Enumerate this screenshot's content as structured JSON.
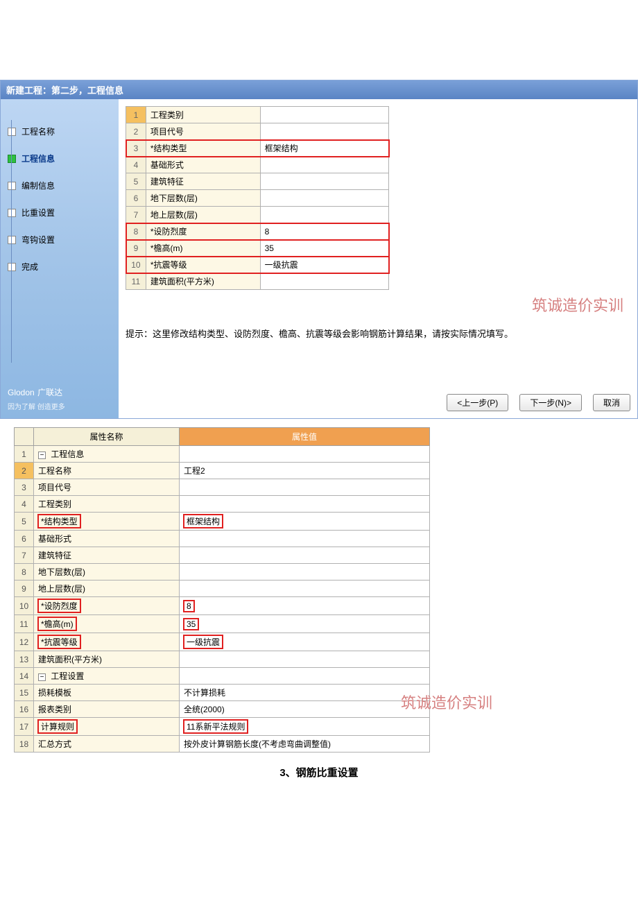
{
  "dialog": {
    "title": "新建工程：第二步，工程信息",
    "nav": [
      "工程名称",
      "工程信息",
      "编制信息",
      "比重设置",
      "弯钩设置",
      "完成"
    ],
    "brand": "Glodon",
    "brand_cn": "广联达",
    "slogan": "因为了解 创造更多",
    "tip": "提示：这里修改结构类型、设防烈度、檐高、抗震等级会影响钢筋计算结果，请按实际情况填写。",
    "buttons": {
      "prev": "<上一步(P)",
      "next": "下一步(N)>",
      "cancel": "取消"
    },
    "rows": [
      {
        "n": "1",
        "label": "工程类别",
        "val": ""
      },
      {
        "n": "2",
        "label": "项目代号",
        "val": ""
      },
      {
        "n": "3",
        "label": "*结构类型",
        "val": "框架结构",
        "red": true
      },
      {
        "n": "4",
        "label": "基础形式",
        "val": ""
      },
      {
        "n": "5",
        "label": "建筑特征",
        "val": ""
      },
      {
        "n": "6",
        "label": "地下层数(层)",
        "val": ""
      },
      {
        "n": "7",
        "label": "地上层数(层)",
        "val": ""
      },
      {
        "n": "8",
        "label": "*设防烈度",
        "val": "8",
        "red": true
      },
      {
        "n": "9",
        "label": "*檐高(m)",
        "val": "35",
        "red": true
      },
      {
        "n": "10",
        "label": "*抗震等级",
        "val": "一级抗震",
        "red": true
      },
      {
        "n": "11",
        "label": "建筑面积(平方米)",
        "val": ""
      }
    ]
  },
  "table2": {
    "header_name": "属性名称",
    "header_val": "属性值",
    "rows": [
      {
        "n": "1",
        "label": "工程信息",
        "val": "",
        "group": true
      },
      {
        "n": "2",
        "label": "工程名称",
        "val": "工程2",
        "sel": true
      },
      {
        "n": "3",
        "label": "项目代号",
        "val": ""
      },
      {
        "n": "4",
        "label": "工程类别",
        "val": ""
      },
      {
        "n": "5",
        "label": "*结构类型",
        "val": "框架结构",
        "redlabel": true,
        "redval": true
      },
      {
        "n": "6",
        "label": "基础形式",
        "val": ""
      },
      {
        "n": "7",
        "label": "建筑特征",
        "val": ""
      },
      {
        "n": "8",
        "label": "地下层数(层)",
        "val": ""
      },
      {
        "n": "9",
        "label": "地上层数(层)",
        "val": ""
      },
      {
        "n": "10",
        "label": "*设防烈度",
        "val": "8",
        "redlabel": true,
        "redval": true
      },
      {
        "n": "11",
        "label": "*檐高(m)",
        "val": "35",
        "redlabel": true,
        "redval": true
      },
      {
        "n": "12",
        "label": "*抗震等级",
        "val": "一级抗震",
        "redlabel": true,
        "redval": true
      },
      {
        "n": "13",
        "label": "建筑面积(平方米)",
        "val": ""
      },
      {
        "n": "14",
        "label": "工程设置",
        "val": "",
        "group": true
      },
      {
        "n": "15",
        "label": "损耗模板",
        "val": "不计算损耗"
      },
      {
        "n": "16",
        "label": "报表类别",
        "val": "全统(2000)"
      },
      {
        "n": "17",
        "label": "计算规则",
        "val": "11系新平法规则",
        "redlabel": true,
        "redval": true
      },
      {
        "n": "18",
        "label": "汇总方式",
        "val": "按外皮计算钢筋长度(不考虑弯曲调整值)"
      }
    ]
  },
  "watermark": "筑诚造价实训",
  "caption": "3、钢筋比重设置"
}
